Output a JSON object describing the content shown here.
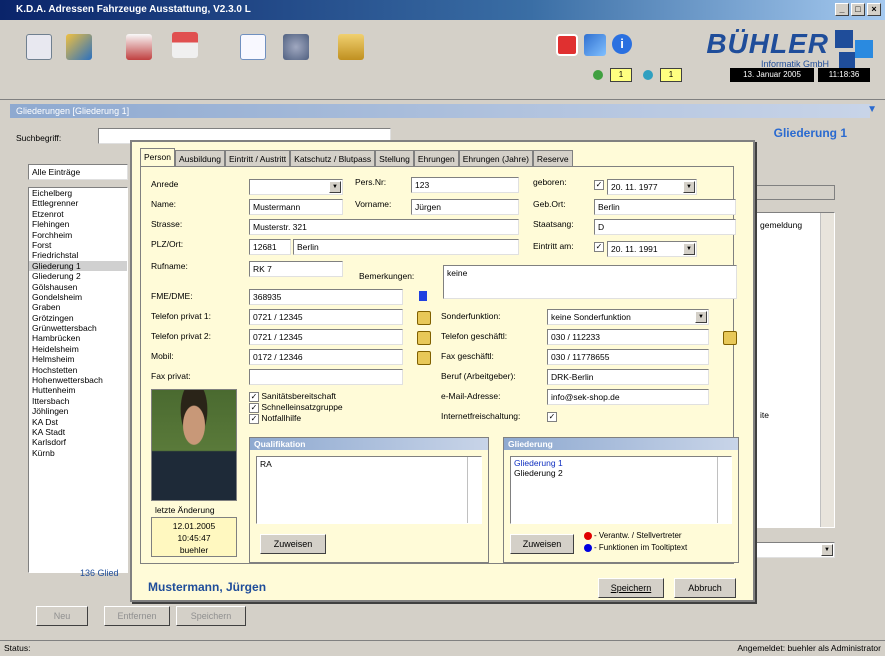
{
  "window": {
    "title": "K.D.A. Adressen Fahrzeuge Ausstattung, V2.3.0 L",
    "controls": [
      "_",
      "□",
      "×"
    ]
  },
  "toolbar": {
    "icons": [
      "chart-icon",
      "tree-icon",
      "document-icon",
      "house-icon",
      "page-icon",
      "tools-icon",
      "folder-icon",
      "stop-icon",
      "users-icon",
      "info-icon"
    ],
    "counter1": "1",
    "counter2": "1",
    "date": "13. Januar 2005",
    "time": "11:18:36",
    "logo_name": "BÜHLER",
    "logo_sub": "Informatik GmbH"
  },
  "panel": {
    "title": "Gliederungen [Gliederung 1]",
    "heading": "Gliederung 1"
  },
  "search": {
    "label": "Suchbegriff:",
    "value": ""
  },
  "filter": {
    "value": "Alle Einträge"
  },
  "left_list": {
    "items": [
      "Eichelberg",
      "Ettlegrenner",
      "Etzenrot",
      "Flehingen",
      "Forchheim",
      "Forst",
      "Friedrichstal",
      "Gliederung 1",
      "Gliederung 2",
      "Gölshausen",
      "Gondelsheim",
      "Graben",
      "Grötzingen",
      "Grünwettersbach",
      "Hambrücken",
      "Heidelsheim",
      "Helmsheim",
      "Hochstetten",
      "Hohenwettersbach",
      "Huttenheim",
      "Ittersbach",
      "Jöhlingen",
      "KA Dst",
      "KA Stadt",
      "Karlsdorf",
      "Kürnb"
    ],
    "selected": "Gliederung 1",
    "count": "136 Glied"
  },
  "right_panel": {
    "col": "gemeldung",
    "row": "ite"
  },
  "bottom_buttons": {
    "new": "Neu",
    "delete": "Entfernen",
    "save": "Speichern"
  },
  "dialog": {
    "tabs": [
      "Person",
      "Ausbildung",
      "Eintritt / Austritt",
      "Katschutz / Blutpass",
      "Stellung",
      "Ehrungen",
      "Ehrungen (Jahre)",
      "Reserve"
    ],
    "fields": {
      "anrede": {
        "label": "Anrede",
        "value": ""
      },
      "persnr": {
        "label": "Pers.Nr:",
        "value": "123"
      },
      "geboren": {
        "label": "geboren:",
        "value": "20. 11. 1977"
      },
      "name": {
        "label": "Name:",
        "value": "Mustermann"
      },
      "vorname": {
        "label": "Vorname:",
        "value": "Jürgen"
      },
      "gebort": {
        "label": "Geb.Ort:",
        "value": "Berlin"
      },
      "strasse": {
        "label": "Strasse:",
        "value": "Musterstr. 321"
      },
      "staatsang": {
        "label": "Staatsang:",
        "value": "D"
      },
      "plz": {
        "label": "PLZ/Ort:",
        "value": "12681"
      },
      "ort": {
        "value": "Berlin"
      },
      "eintritt": {
        "label": "Eintritt am:",
        "value": "20. 11. 1991"
      },
      "funkname": {
        "label": "Rufname:",
        "value": "RK 7"
      },
      "bemerkungen": {
        "label": "Bemerkungen:",
        "value": "keine"
      },
      "fme": {
        "label": "FME/DME:",
        "value": "368935"
      },
      "telpriv1": {
        "label": "Telefon privat 1:",
        "value": "0721 / 12345"
      },
      "telpriv2": {
        "label": "Telefon privat 2:",
        "value": "0721 / 12345"
      },
      "mobil": {
        "label": "Mobil:",
        "value": "0172 / 12346"
      },
      "faxpriv": {
        "label": "Fax privat:",
        "value": ""
      },
      "sonderfunktion": {
        "label": "Sonderfunktion:",
        "value": "keine Sonderfunktion"
      },
      "telgesch": {
        "label": "Telefon geschäftl:",
        "value": "030 / 112233"
      },
      "faxgesch": {
        "label": "Fax geschäftl:",
        "value": "030 / 11778655"
      },
      "beruf": {
        "label": "Beruf (Arbeitgeber):",
        "value": "DRK-Berlin"
      },
      "email": {
        "label": "e-Mail-Adresse:",
        "value": "info@sek-shop.de"
      },
      "internet": {
        "label": "Internetfreischaltung:"
      }
    },
    "checkboxes": [
      "Sanitätsbereitschaft",
      "Schnelleinsatzgruppe",
      "Notfallhilfe"
    ],
    "photo_caption": "letzte Änderung",
    "last_change": {
      "date": "12.01.2005",
      "time": "10:45:47",
      "user": "buehler"
    },
    "qualifikation": {
      "title": "Qualifikation",
      "items": [
        "RA"
      ],
      "button": "Zuweisen"
    },
    "gliederung": {
      "title": "Gliederung",
      "items": [
        "Gliederung 1",
        "Gliederung 2"
      ],
      "button": "Zuweisen"
    },
    "legend": {
      "red": "- Verantw. / Stellvertreter",
      "blue": "- Funktionen im Tooltiptext",
      "red_color": "#e00000",
      "blue_color": "#0000e0"
    },
    "person_name": "Mustermann, Jürgen",
    "save": "Speichern",
    "cancel": "Abbruch"
  },
  "status": {
    "left": "Status:",
    "right": "Angemeldet: buehler als Administrator"
  }
}
